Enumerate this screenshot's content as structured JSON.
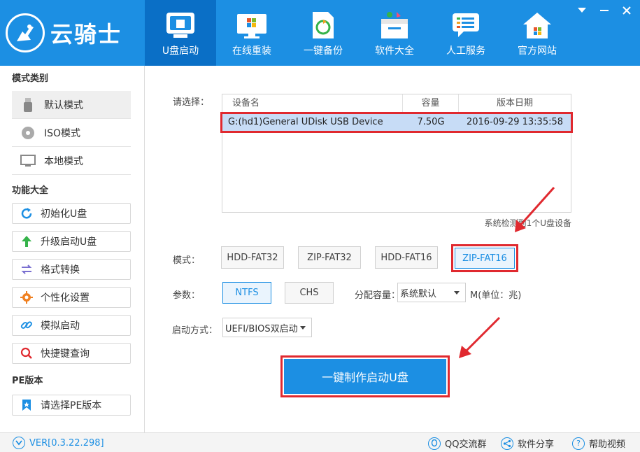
{
  "app": {
    "logo_text": "云骑士"
  },
  "nav": [
    {
      "label": "U盘启动",
      "icon": "usb-drive-icon"
    },
    {
      "label": "在线重装",
      "icon": "windows-monitor-icon"
    },
    {
      "label": "一键备份",
      "icon": "backup-icon"
    },
    {
      "label": "软件大全",
      "icon": "software-box-icon"
    },
    {
      "label": "人工服务",
      "icon": "chat-service-icon"
    },
    {
      "label": "官方网站",
      "icon": "home-icon"
    }
  ],
  "sidebar": {
    "mode_title": "模式类别",
    "modes": [
      {
        "label": "默认模式",
        "icon": "usb-stick-icon"
      },
      {
        "label": "ISO模式",
        "icon": "disc-icon"
      },
      {
        "label": "本地模式",
        "icon": "monitor-icon"
      }
    ],
    "func_title": "功能大全",
    "functions": [
      {
        "label": "初始化U盘",
        "icon": "refresh-icon"
      },
      {
        "label": "升级启动U盘",
        "icon": "arrow-up-icon"
      },
      {
        "label": "格式转换",
        "icon": "convert-arrows-icon"
      },
      {
        "label": "个性化设置",
        "icon": "gear-icon"
      },
      {
        "label": "模拟启动",
        "icon": "link-icon"
      },
      {
        "label": "快捷键查询",
        "icon": "search-icon"
      }
    ],
    "pe_title": "PE版本",
    "pe_button": {
      "label": "请选择PE版本",
      "icon": "bookmark-icon"
    }
  },
  "main": {
    "select_label": "请选择：",
    "table": {
      "headers": [
        "设备名",
        "容量",
        "版本日期"
      ],
      "rows": [
        [
          "G:(hd1)General UDisk USB Device",
          "7.50G",
          "2016-09-29 13:35:58"
        ]
      ]
    },
    "detect_note": "系统检测到1个U盘设备",
    "mode_label": "模式：",
    "modes": [
      "HDD-FAT32",
      "ZIP-FAT32",
      "HDD-FAT16",
      "ZIP-FAT16"
    ],
    "params_label": "参数：",
    "params": [
      "NTFS",
      "CHS"
    ],
    "alloc_label": "分配容量：",
    "alloc_value": "系统默认",
    "alloc_unit": "M(单位：兆)",
    "boot_label": "启动方式：",
    "boot_value": "UEFI/BIOS双启动",
    "make_button": "一键制作启动U盘"
  },
  "footer": {
    "version": "VER[0.3.22.298]",
    "qq": "QQ交流群",
    "share": "软件分享",
    "help": "帮助视频"
  },
  "colors": {
    "primary": "#1c8fe3",
    "nav_active": "#0a6fc6",
    "highlight": "#e0292f"
  }
}
